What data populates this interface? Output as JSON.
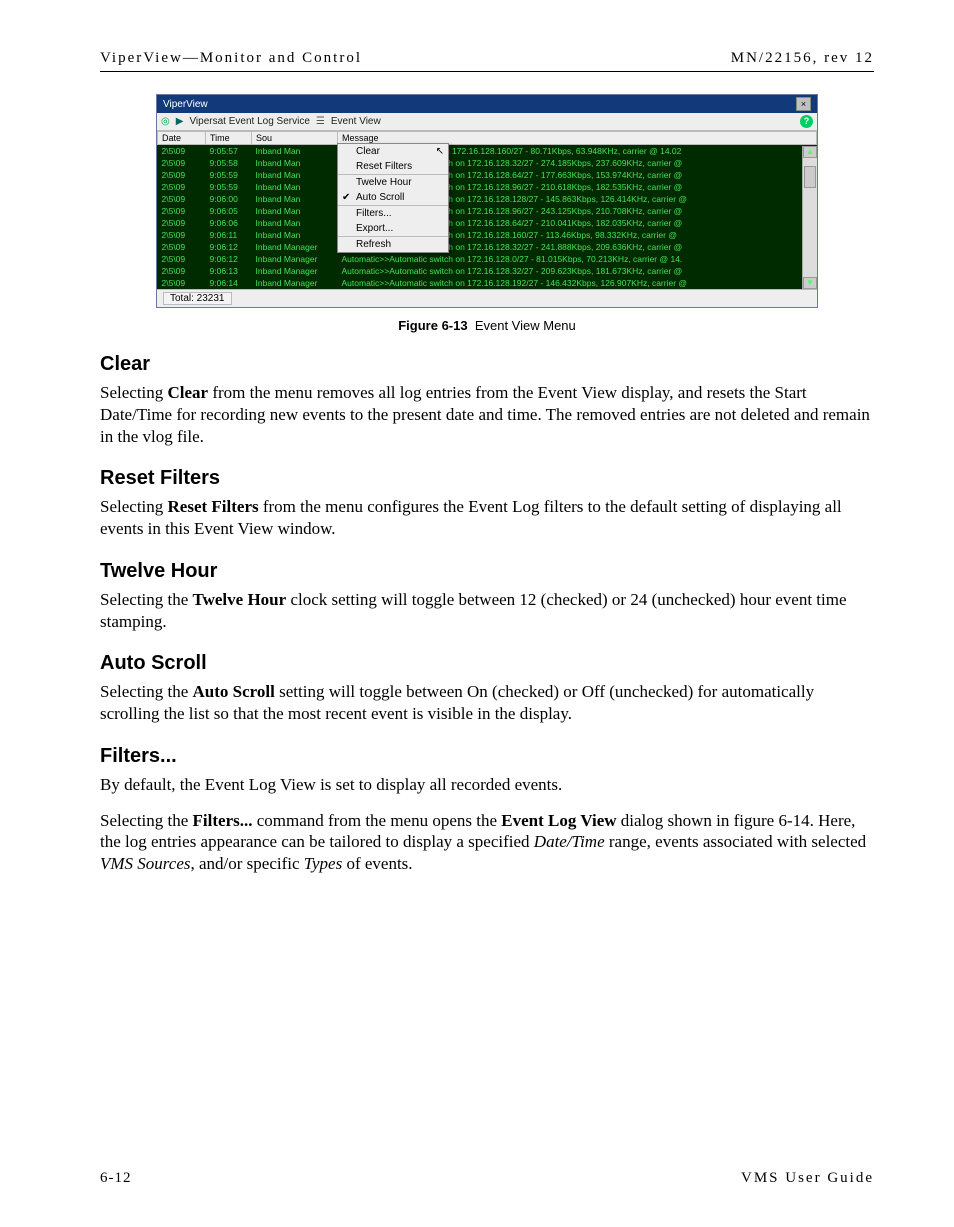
{
  "header": {
    "left": "ViperView—Monitor and Control",
    "right": "MN/22156, rev 12"
  },
  "screenshot": {
    "title": "ViperView",
    "crumb": {
      "service": "Vipersat Event Log Service",
      "view": "Event View"
    },
    "columns": {
      "date": "Date",
      "time": "Time",
      "source": "Sou",
      "message": "Message"
    },
    "menu": {
      "clear": "Clear",
      "reset": "Reset Filters",
      "twelve": "Twelve Hour",
      "auto": "Auto Scroll",
      "filters": "Filters...",
      "export": "Export...",
      "refresh": "Refresh"
    },
    "rows": [
      {
        "date": "2\\5\\09",
        "time": "9:05:57",
        "source": "Inband Man",
        "msg": "Home>>Automatic switch on 172.16.128.160/27 - 80.71Kbps, 63.948KHz, carrier @ 14.02"
      },
      {
        "date": "2\\5\\09",
        "time": "9:05:58",
        "source": "Inband Man",
        "msg": "Automatic>>Automatic switch on 172.16.128.32/27 - 274.185Kbps, 237.609KHz, carrier @"
      },
      {
        "date": "2\\5\\09",
        "time": "9:05:59",
        "source": "Inband Man",
        "msg": "Automatic>>Automatic switch on 172.16.128.64/27 - 177.663Kbps, 153.974KHz, carrier @"
      },
      {
        "date": "2\\5\\09",
        "time": "9:05:59",
        "source": "Inband Man",
        "msg": "Automatic>>Automatic switch on 172.16.128.96/27 - 210.618Kbps, 182.535KHz, carrier @"
      },
      {
        "date": "2\\5\\09",
        "time": "9:06:00",
        "source": "Inband Man",
        "msg": "Automatic>>Automatic switch on 172.16.128.128/27 - 145.863Kbps, 126.414KHz, carrier @"
      },
      {
        "date": "2\\5\\09",
        "time": "9:06:05",
        "source": "Inband Man",
        "msg": "Automatic>>Automatic switch on 172.16.128.96/27 - 243.125Kbps, 210.708KHz, carrier @"
      },
      {
        "date": "2\\5\\09",
        "time": "9:06:06",
        "source": "Inband Man",
        "msg": "Automatic>>Automatic switch on 172.16.128.64/27 - 210.041Kbps, 182.035KHz, carrier @"
      },
      {
        "date": "2\\5\\09",
        "time": "9:06:11",
        "source": "Inband Man",
        "msg": "Automatic>>Automatic switch on 172.16.128.160/27 - 113.46Kbps, 98.332KHz, carrier @"
      },
      {
        "date": "2\\5\\09",
        "time": "9:06:12",
        "source": "Inband Manager",
        "msg": "Automatic>>Automatic switch on 172.16.128.32/27 - 241.888Kbps, 209.636KHz, carrier @"
      },
      {
        "date": "2\\5\\09",
        "time": "9:06:12",
        "source": "Inband Manager",
        "msg": "Automatic>>Automatic switch on 172.16.128.0/27 - 81.015Kbps, 70.213KHz, carrier @ 14."
      },
      {
        "date": "2\\5\\09",
        "time": "9:06:13",
        "source": "Inband Manager",
        "msg": "Automatic>>Automatic switch on 172.16.128.32/27 - 209.623Kbps, 181.673KHz, carrier @"
      },
      {
        "date": "2\\5\\09",
        "time": "9:06:14",
        "source": "Inband Manager",
        "msg": "Automatic>>Automatic switch on 172.16.128.192/27 - 146.432Kbps, 126.907KHz, carrier @"
      }
    ],
    "status": "Total: 23231"
  },
  "figure": {
    "label": "Figure 6-13",
    "caption": "Event View Menu"
  },
  "sections": {
    "clear": {
      "title": "Clear",
      "body1a": "Selecting ",
      "body1b": "Clear",
      "body1c": " from the menu removes all log entries from the Event View display, and resets the Start Date/Time for recording new events to the present date and time. The removed entries are not deleted and remain in the vlog file."
    },
    "reset": {
      "title": "Reset Filters",
      "body1a": "Selecting ",
      "body1b": "Reset Filters",
      "body1c": " from the menu configures the Event Log filters to the default setting of displaying all events in this Event View window."
    },
    "twelve": {
      "title": "Twelve Hour",
      "body1a": "Selecting the ",
      "body1b": "Twelve Hour",
      "body1c": " clock setting will toggle between 12 (checked) or 24 (unchecked) hour event time stamping."
    },
    "auto": {
      "title": "Auto Scroll",
      "body1a": "Selecting the ",
      "body1b": "Auto Scroll",
      "body1c": " setting will toggle between On (checked) or Off (unchecked) for automatically scrolling the list so that the most recent event is visible in the display."
    },
    "filters": {
      "title": "Filters...",
      "body1": "By default, the Event Log View is set to display all recorded events.",
      "body2a": "Selecting the ",
      "body2b": "Filters...",
      "body2c": " command from the menu opens the ",
      "body2d": "Event Log View",
      "body2e": " dialog shown in figure 6-14. Here, the log entries appearance can be tailored to display a specified ",
      "body2f": "Date/Time",
      "body2g": " range, events associated with selected ",
      "body2h": "VMS Sources",
      "body2i": ", and/or specific ",
      "body2j": "Types",
      "body2k": " of events."
    }
  },
  "footer": {
    "left": "6-12",
    "right": "VMS User Guide"
  }
}
